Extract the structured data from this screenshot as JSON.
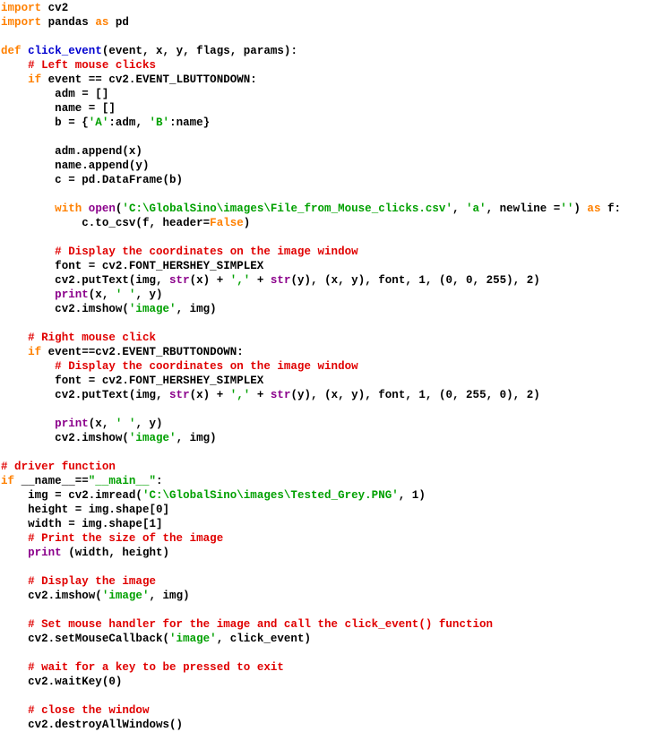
{
  "document": {
    "kind": "source-code-screenshot",
    "language": "Python",
    "background_color": "#ffffff",
    "syntax_colors": {
      "keyword": "#ff8000",
      "function_name": "#0000d0",
      "comment": "#e00000",
      "string": "#00a000",
      "builtin": "#8b008b",
      "plain_text": "#000000"
    }
  },
  "code": {
    "lines": [
      [
        {
          "t": "import",
          "c": "kw"
        },
        {
          "t": " cv2",
          "c": "pl"
        }
      ],
      [
        {
          "t": "import",
          "c": "kw"
        },
        {
          "t": " pandas ",
          "c": "pl"
        },
        {
          "t": "as",
          "c": "kw"
        },
        {
          "t": " pd",
          "c": "pl"
        }
      ],
      [],
      [
        {
          "t": "def",
          "c": "kw"
        },
        {
          "t": " ",
          "c": "pl"
        },
        {
          "t": "click_event",
          "c": "fn"
        },
        {
          "t": "(event, x, y, flags, params):",
          "c": "pl"
        }
      ],
      [
        {
          "t": "    ",
          "c": "pl"
        },
        {
          "t": "# Left mouse clicks",
          "c": "cm"
        }
      ],
      [
        {
          "t": "    ",
          "c": "pl"
        },
        {
          "t": "if",
          "c": "kw"
        },
        {
          "t": " event == cv2.EVENT_LBUTTONDOWN:",
          "c": "pl"
        }
      ],
      [
        {
          "t": "        adm = []",
          "c": "pl"
        }
      ],
      [
        {
          "t": "        name = []",
          "c": "pl"
        }
      ],
      [
        {
          "t": "        b = {",
          "c": "pl"
        },
        {
          "t": "'A'",
          "c": "st"
        },
        {
          "t": ":adm, ",
          "c": "pl"
        },
        {
          "t": "'B'",
          "c": "st"
        },
        {
          "t": ":name}",
          "c": "pl"
        }
      ],
      [],
      [
        {
          "t": "        adm.append(x)",
          "c": "pl"
        }
      ],
      [
        {
          "t": "        name.append(y)",
          "c": "pl"
        }
      ],
      [
        {
          "t": "        c = pd.DataFrame(b)",
          "c": "pl"
        }
      ],
      [],
      [
        {
          "t": "        ",
          "c": "pl"
        },
        {
          "t": "with",
          "c": "kw"
        },
        {
          "t": " ",
          "c": "pl"
        },
        {
          "t": "open",
          "c": "bi"
        },
        {
          "t": "(",
          "c": "pl"
        },
        {
          "t": "'C:\\GlobalSino\\images\\File_from_Mouse_clicks.csv'",
          "c": "st"
        },
        {
          "t": ", ",
          "c": "pl"
        },
        {
          "t": "'a'",
          "c": "st"
        },
        {
          "t": ", newline =",
          "c": "pl"
        },
        {
          "t": "''",
          "c": "st"
        },
        {
          "t": ") ",
          "c": "pl"
        },
        {
          "t": "as",
          "c": "kw"
        },
        {
          "t": " f:",
          "c": "pl"
        }
      ],
      [
        {
          "t": "            c.to_csv(f, header=",
          "c": "pl"
        },
        {
          "t": "False",
          "c": "kw"
        },
        {
          "t": ")",
          "c": "pl"
        }
      ],
      [],
      [
        {
          "t": "        ",
          "c": "pl"
        },
        {
          "t": "# Display the coordinates on the image window",
          "c": "cm"
        }
      ],
      [
        {
          "t": "        font = cv2.FONT_HERSHEY_SIMPLEX",
          "c": "pl"
        }
      ],
      [
        {
          "t": "        cv2.putText(img, ",
          "c": "pl"
        },
        {
          "t": "str",
          "c": "bi"
        },
        {
          "t": "(x) + ",
          "c": "pl"
        },
        {
          "t": "','",
          "c": "st"
        },
        {
          "t": " + ",
          "c": "pl"
        },
        {
          "t": "str",
          "c": "bi"
        },
        {
          "t": "(y), (x, y), font, 1, (0, 0, 255), 2)",
          "c": "pl"
        }
      ],
      [
        {
          "t": "        ",
          "c": "pl"
        },
        {
          "t": "print",
          "c": "bi"
        },
        {
          "t": "(x, ",
          "c": "pl"
        },
        {
          "t": "' '",
          "c": "st"
        },
        {
          "t": ", y)",
          "c": "pl"
        }
      ],
      [
        {
          "t": "        cv2.imshow(",
          "c": "pl"
        },
        {
          "t": "'image'",
          "c": "st"
        },
        {
          "t": ", img)",
          "c": "pl"
        }
      ],
      [],
      [
        {
          "t": "    ",
          "c": "pl"
        },
        {
          "t": "# Right mouse click",
          "c": "cm"
        }
      ],
      [
        {
          "t": "    ",
          "c": "pl"
        },
        {
          "t": "if",
          "c": "kw"
        },
        {
          "t": " event==cv2.EVENT_RBUTTONDOWN:",
          "c": "pl"
        }
      ],
      [
        {
          "t": "        ",
          "c": "pl"
        },
        {
          "t": "# Display the coordinates on the image window",
          "c": "cm"
        }
      ],
      [
        {
          "t": "        font = cv2.FONT_HERSHEY_SIMPLEX",
          "c": "pl"
        }
      ],
      [
        {
          "t": "        cv2.putText(img, ",
          "c": "pl"
        },
        {
          "t": "str",
          "c": "bi"
        },
        {
          "t": "(x) + ",
          "c": "pl"
        },
        {
          "t": "','",
          "c": "st"
        },
        {
          "t": " + ",
          "c": "pl"
        },
        {
          "t": "str",
          "c": "bi"
        },
        {
          "t": "(y), (x, y), font, 1, (0, 255, 0), 2)",
          "c": "pl"
        }
      ],
      [],
      [
        {
          "t": "        ",
          "c": "pl"
        },
        {
          "t": "print",
          "c": "bi"
        },
        {
          "t": "(x, ",
          "c": "pl"
        },
        {
          "t": "' '",
          "c": "st"
        },
        {
          "t": ", y)",
          "c": "pl"
        }
      ],
      [
        {
          "t": "        cv2.imshow(",
          "c": "pl"
        },
        {
          "t": "'image'",
          "c": "st"
        },
        {
          "t": ", img)",
          "c": "pl"
        }
      ],
      [],
      [
        {
          "t": "# driver function",
          "c": "cm"
        }
      ],
      [
        {
          "t": "if",
          "c": "kw"
        },
        {
          "t": " __name__==",
          "c": "pl"
        },
        {
          "t": "\"__main__\"",
          "c": "st"
        },
        {
          "t": ":",
          "c": "pl"
        }
      ],
      [
        {
          "t": "    img = cv2.imread(",
          "c": "pl"
        },
        {
          "t": "'C:\\GlobalSino\\images\\Tested_Grey.PNG'",
          "c": "st"
        },
        {
          "t": ", 1)",
          "c": "pl"
        }
      ],
      [
        {
          "t": "    height = img.shape[0]",
          "c": "pl"
        }
      ],
      [
        {
          "t": "    width = img.shape[1]",
          "c": "pl"
        }
      ],
      [
        {
          "t": "    ",
          "c": "pl"
        },
        {
          "t": "# Print the size of the image",
          "c": "cm"
        }
      ],
      [
        {
          "t": "    ",
          "c": "pl"
        },
        {
          "t": "print",
          "c": "bi"
        },
        {
          "t": " (width, height)",
          "c": "pl"
        }
      ],
      [],
      [
        {
          "t": "    ",
          "c": "pl"
        },
        {
          "t": "# Display the image",
          "c": "cm"
        }
      ],
      [
        {
          "t": "    cv2.imshow(",
          "c": "pl"
        },
        {
          "t": "'image'",
          "c": "st"
        },
        {
          "t": ", img)",
          "c": "pl"
        }
      ],
      [],
      [
        {
          "t": "    ",
          "c": "pl"
        },
        {
          "t": "# Set mouse handler for the image and call the click_event() function",
          "c": "cm"
        }
      ],
      [
        {
          "t": "    cv2.setMouseCallback(",
          "c": "pl"
        },
        {
          "t": "'image'",
          "c": "st"
        },
        {
          "t": ", click_event)",
          "c": "pl"
        }
      ],
      [],
      [
        {
          "t": "    ",
          "c": "pl"
        },
        {
          "t": "# wait for a key to be pressed to exit",
          "c": "cm"
        }
      ],
      [
        {
          "t": "    cv2.waitKey(0)",
          "c": "pl"
        }
      ],
      [],
      [
        {
          "t": "    ",
          "c": "pl"
        },
        {
          "t": "# close the window",
          "c": "cm"
        }
      ],
      [
        {
          "t": "    cv2.destroyAllWindows()",
          "c": "pl"
        }
      ]
    ]
  }
}
